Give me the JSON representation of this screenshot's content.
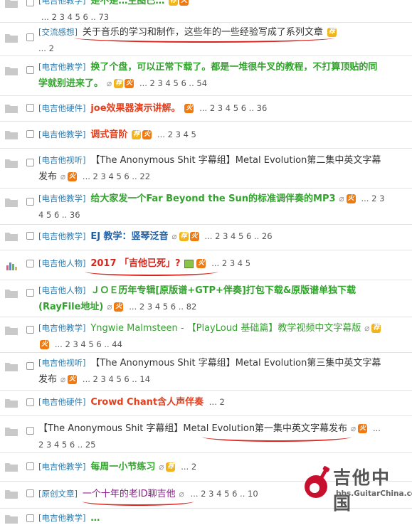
{
  "pager": {
    "dots": "...",
    "sep": "2 3 4 5 6 ..",
    "last": "...2"
  },
  "rows": [
    {
      "cat": "[电吉他教学]",
      "title": "是不是…主图已…",
      "pages_text": "... 2 3 4 5 6 .. 73"
    },
    {
      "cat": "[交流感想]",
      "title": "关于音乐的学习和制作，这些年的一些经验写成了系列文章",
      "pages_text": "... 2"
    },
    {
      "cat": "[电吉他教学]",
      "title": "换了个盘，可以正常下载了。都是一堆很牛叉的教程，不打算顶贴的同学就别进来了。",
      "pages_text": "... 2 3 4 5 6 .. 54"
    },
    {
      "cat": "[电吉他硬件]",
      "title": "joe效果器演示讲解。",
      "pages_text": "... 2 3 4 5 6 .. 36"
    },
    {
      "cat": "[电吉他教学]",
      "title": "调式音阶",
      "pages_text": "... 2 3 4 5"
    },
    {
      "cat": "[电吉他视听]",
      "title": "【The Anonymous Shit 字幕组】Metal Evolution第二集中英文字幕发布",
      "pages_text": "... 2 3 4 5 6 .. 22"
    },
    {
      "cat": "[电吉他教学]",
      "title": "给大家发一个Far Beyond the Sun的标准调伴奏的MP3",
      "pages_text": "... 2 3 4 5 6 .. 36"
    },
    {
      "cat": "[电吉他教学]",
      "title": "EJ 教学：竖琴泛音",
      "pages_text": "... 2 3 4 5 6 .. 26"
    },
    {
      "cat": "[电吉他人物]",
      "title": "2017 「吉他已死」?",
      "pages_text": "... 2 3 4 5"
    },
    {
      "cat": "[电吉他人物]",
      "title": "ＪＯＥ历年专辑[原版谱+GTP+伴奏]打包下载&原版谱单独下载(RayFile地址)",
      "pages_text": "... 2 3 4 5 6 .. 82"
    },
    {
      "cat": "[电吉他教学]",
      "title": "Yngwie Malmsteen - 【PlayLoud 基础篇】教学视频中文字幕版",
      "pages_text": "... 2 3 4 5 6 .. 44"
    },
    {
      "cat": "[电吉他视听]",
      "title": "【The Anonymous Shit 字幕组】Metal Evolution第三集中英文字幕发布",
      "pages_text": "... 2 3 4 5 6 .. 14"
    },
    {
      "cat": "[电吉他硬件]",
      "title": "Crowd Chant含人声伴奏",
      "pages_text": "... 2"
    },
    {
      "cat": "",
      "title": "【The Anonymous Shit 字幕组】Metal Evolution第一集中英文字幕发布",
      "pages_text": "... 2 3 4 5 6 .. 25"
    },
    {
      "cat": "[电吉他教学]",
      "title": "每周一小节练习",
      "pages_text": "... 2"
    },
    {
      "cat": "[原创文章]",
      "title": "一个十年的老ID聊吉他",
      "pages_text": "... 2 3 4 5 6 .. 10"
    },
    {
      "cat": "[电吉他教学]",
      "title": "…",
      "pages_text": ""
    }
  ],
  "badges": {
    "rec": "荐",
    "hot": "火"
  },
  "logo": {
    "name": "吉他中国",
    "url": "bbs.GuitarChina.com"
  },
  "colors": {
    "accent_red": "#d7261e",
    "cat_blue": "#2b7bb0",
    "title_green": "#33a12d"
  }
}
